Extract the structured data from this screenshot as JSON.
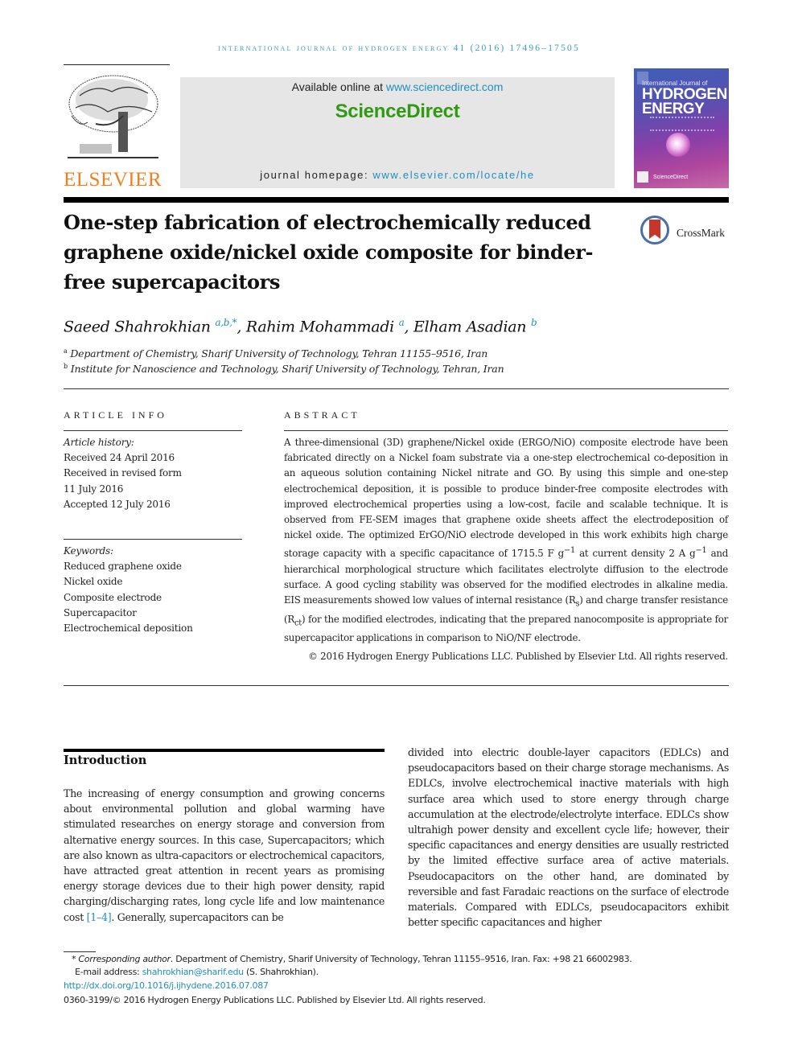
{
  "running_head": "International Journal of Hydrogen Energy 41 (2016) 17496–17505",
  "publisher": {
    "logo_word": "ELSEVIER",
    "brand_color": "#f07f1e"
  },
  "sciencedirect": {
    "available_prefix": "Available online at ",
    "available_link": "www.sciencedirect.com",
    "logo_text": "ScienceDirect",
    "logo_color": "#2f9a12",
    "homepage_prefix": "journal homepage: ",
    "homepage_link": "www.elsevier.com/locate/he",
    "link_color": "#1f8fc0"
  },
  "cover": {
    "line1": "International Journal of",
    "line2": "HYDROGEN",
    "line3": "ENERGY",
    "footer": "ScienceDirect"
  },
  "article": {
    "title": "One-step fabrication of electrochemically reduced graphene oxide/nickel oxide composite for binder-free supercapacitors",
    "crossmark_label": "CrossMark",
    "authors": [
      {
        "name": "Saeed Shahrokhian",
        "sup": "a,b,*",
        "sep": ", "
      },
      {
        "name": "Rahim Mohammadi",
        "sup": "a",
        "sep": ", "
      },
      {
        "name": "Elham Asadian",
        "sup": "b",
        "sep": ""
      }
    ],
    "affiliations": [
      {
        "mark": "a",
        "text": "Department of Chemistry, Sharif University of Technology, Tehran 11155–9516, Iran"
      },
      {
        "mark": "b",
        "text": "Institute for Nanoscience and Technology, Sharif University of Technology, Tehran, Iran"
      }
    ]
  },
  "article_info": {
    "heading": "ARTICLE INFO",
    "history_label": "Article history:",
    "history": [
      "Received 24 April 2016",
      "Received in revised form",
      "11 July 2016",
      "Accepted 12 July 2016"
    ],
    "keywords_label": "Keywords:",
    "keywords": [
      "Reduced graphene oxide",
      "Nickel oxide",
      "Composite electrode",
      "Supercapacitor",
      "Electrochemical deposition"
    ]
  },
  "abstract": {
    "heading": "ABSTRACT",
    "p1": "A three-dimensional (3D) graphene/Nickel oxide (ERGO/NiO) composite electrode have been fabricated directly on a Nickel foam substrate via a one-step electrochemical co-deposition in an aqueous solution containing Nickel nitrate and GO. By using this simple and one-step electrochemical deposition, it is possible to produce binder-free composite electrodes with improved electrochemical properties using a low-cost, facile and scalable technique. It is observed from FE-SEM images that graphene oxide sheets affect the electrodeposition of nickel oxide. The optimized ErGO/NiO electrode developed in this work exhibits high charge storage capacity with a specific capacitance of 1715.5 F g",
    "sup1": "−1",
    "p2": " at current density 2 A g",
    "sup2": "−1",
    "p3": " and hierarchical morphological structure which facilitates electrolyte diffusion to the electrode surface. A good cycling stability was observed for the modified electrodes in alkaline media. EIS measurements showed low values of internal resistance (R",
    "sub1": "s",
    "p4": ") and charge transfer resistance (R",
    "sub2": "ct",
    "p5": ") for the modified electrodes, indicating that the prepared nanocomposite is appropriate for supercapacitor applications in comparison to NiO/NF electrode.",
    "copyright": "© 2016 Hydrogen Energy Publications LLC. Published by Elsevier Ltd. All rights reserved."
  },
  "introduction": {
    "heading": "Introduction",
    "left_text_a": "The increasing of energy consumption and growing concerns about environmental pollution and global warming have stimulated researches on energy storage and conversion from alternative energy sources. In this case, Supercapacitors; which are also known as ultra-capacitors or electrochemical capacitors, have attracted great attention in recent years as promising energy storage devices due to their high power density, rapid charging/discharging rates, long cycle life and low maintenance cost ",
    "left_ref": "[1–4]",
    "left_text_b": ". Generally, supercapacitors can be",
    "right_text": "divided into electric double-layer capacitors (EDLCs) and pseudocapacitors based on their charge storage mechanisms. As EDLCs, involve electrochemical inactive materials with high surface area which used to store energy through charge accumulation at the electrode/electrolyte interface. EDLCs show ultrahigh power density and excellent cycle life; however, their specific capacitances and energy densities are usually restricted by the limited effective surface area of active materials. Pseudocapacitors on the other hand, are dominated by reversible and fast Faradaic reactions on the surface of electrode materials. Compared with EDLCs, pseudocapacitors exhibit better specific capacitances and higher"
  },
  "footnotes": {
    "star": "*",
    "corresponding_label": "Corresponding author",
    "corresponding_text": ". Department of Chemistry, Sharif University of Technology, Tehran 11155–9516, Iran. Fax: +98 21 66002983.",
    "email_label": "E-mail address: ",
    "email": "shahrokhian@sharif.edu",
    "email_suffix": " (S. Shahrokhian).",
    "doi": "http://dx.doi.org/10.1016/j.ijhydene.2016.07.087",
    "issn_line": "0360-3199/© 2016 Hydrogen Energy Publications LLC. Published by Elsevier Ltd. All rights reserved."
  }
}
